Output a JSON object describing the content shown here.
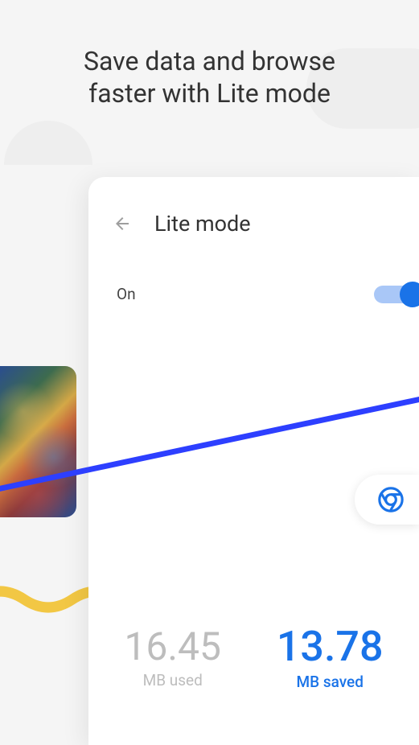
{
  "headline": "Save data and browse\nfaster with Lite mode",
  "card": {
    "title": "Lite mode",
    "toggle_label": "On",
    "toggle_state": true
  },
  "stats": {
    "used_value": "16.45",
    "used_label": "MB used",
    "saved_value": "13.78",
    "saved_label": "MB saved"
  }
}
